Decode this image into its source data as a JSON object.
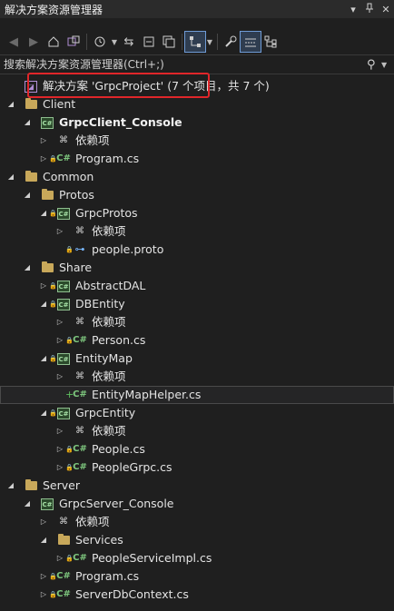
{
  "window": {
    "title": "解决方案资源管理器",
    "pin_glyph": "▾",
    "pin2_glyph": "ᵖ",
    "close_glyph": "✕"
  },
  "search": {
    "placeholder": "搜索解决方案资源管理器(Ctrl+;)"
  },
  "tree": [
    {
      "depth": 0,
      "arrow": "",
      "kind": "solution",
      "label": "解决方案 'GrpcProject' (7 个项目，共 7 个)",
      "bold": false
    },
    {
      "depth": 0,
      "arrow": "◢",
      "kind": "folder",
      "label": "Client"
    },
    {
      "depth": 1,
      "arrow": "◢",
      "kind": "project",
      "label": "GrpcClient_Console",
      "bold": true
    },
    {
      "depth": 2,
      "arrow": "▷",
      "kind": "deps",
      "label": "依赖项"
    },
    {
      "depth": 2,
      "arrow": "▷",
      "kind": "cs",
      "label": "Program.cs",
      "lock": true
    },
    {
      "depth": 0,
      "arrow": "◢",
      "kind": "folder",
      "label": "Common"
    },
    {
      "depth": 1,
      "arrow": "◢",
      "kind": "folder",
      "label": "Protos"
    },
    {
      "depth": 2,
      "arrow": "◢",
      "kind": "project",
      "label": "GrpcProtos",
      "lock": true
    },
    {
      "depth": 3,
      "arrow": "▷",
      "kind": "deps",
      "label": "依赖项"
    },
    {
      "depth": 3,
      "arrow": "",
      "kind": "proto",
      "label": "people.proto",
      "lock": true
    },
    {
      "depth": 1,
      "arrow": "◢",
      "kind": "folder",
      "label": "Share"
    },
    {
      "depth": 2,
      "arrow": "▷",
      "kind": "project",
      "label": "AbstractDAL",
      "lock": true
    },
    {
      "depth": 2,
      "arrow": "◢",
      "kind": "project",
      "label": "DBEntity",
      "lock": true
    },
    {
      "depth": 3,
      "arrow": "▷",
      "kind": "deps",
      "label": "依赖项"
    },
    {
      "depth": 3,
      "arrow": "▷",
      "kind": "cs",
      "label": "Person.cs",
      "lock": true
    },
    {
      "depth": 2,
      "arrow": "◢",
      "kind": "project",
      "label": "EntityMap",
      "lock": true
    },
    {
      "depth": 3,
      "arrow": "▷",
      "kind": "deps",
      "label": "依赖项"
    },
    {
      "depth": 3,
      "arrow": "",
      "kind": "cs",
      "label": "EntityMapHelper.cs",
      "plus": true,
      "selected": true
    },
    {
      "depth": 2,
      "arrow": "◢",
      "kind": "project",
      "label": "GrpcEntity",
      "lock": true
    },
    {
      "depth": 3,
      "arrow": "▷",
      "kind": "deps",
      "label": "依赖项"
    },
    {
      "depth": 3,
      "arrow": "▷",
      "kind": "cs",
      "label": "People.cs",
      "lock": true
    },
    {
      "depth": 3,
      "arrow": "▷",
      "kind": "cs",
      "label": "PeopleGrpc.cs",
      "lock": true
    },
    {
      "depth": 0,
      "arrow": "◢",
      "kind": "folder",
      "label": "Server"
    },
    {
      "depth": 1,
      "arrow": "◢",
      "kind": "project",
      "label": "GrpcServer_Console"
    },
    {
      "depth": 2,
      "arrow": "▷",
      "kind": "deps",
      "label": "依赖项"
    },
    {
      "depth": 2,
      "arrow": "◢",
      "kind": "folder",
      "label": "Services"
    },
    {
      "depth": 3,
      "arrow": "▷",
      "kind": "cs",
      "label": "PeopleServiceImpl.cs",
      "lock": true
    },
    {
      "depth": 2,
      "arrow": "▷",
      "kind": "cs",
      "label": "Program.cs",
      "lock": true
    },
    {
      "depth": 2,
      "arrow": "▷",
      "kind": "cs",
      "label": "ServerDbContext.cs",
      "lock": true
    }
  ]
}
